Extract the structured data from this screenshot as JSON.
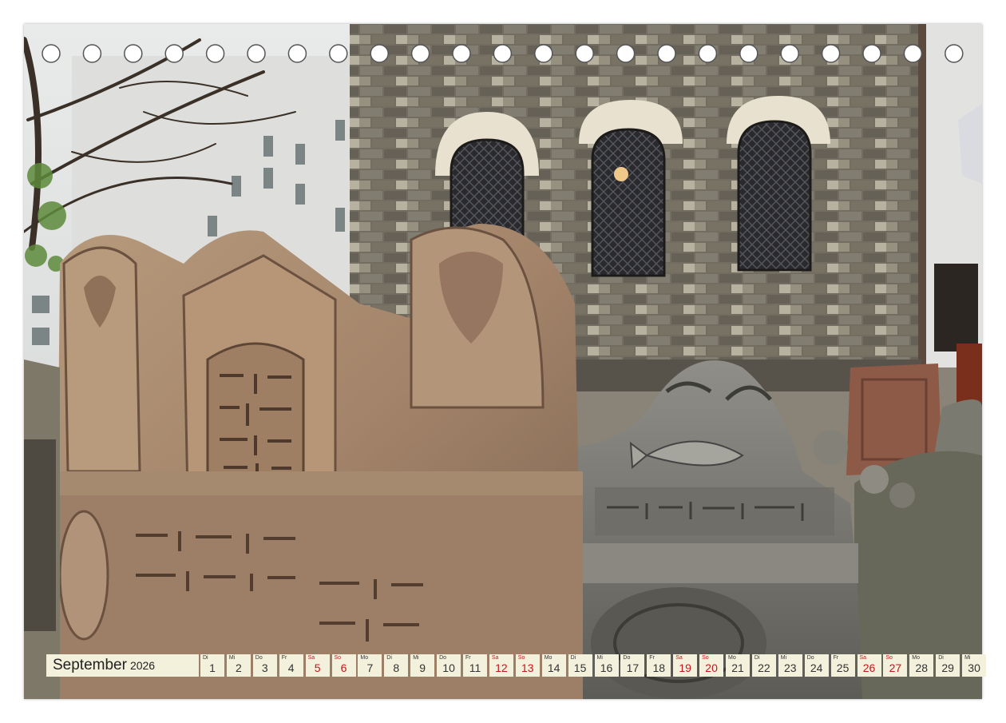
{
  "calendar": {
    "month": "September",
    "year": "2026",
    "days": [
      {
        "wd": "Di",
        "d": "1",
        "we": false
      },
      {
        "wd": "Mi",
        "d": "2",
        "we": false
      },
      {
        "wd": "Do",
        "d": "3",
        "we": false
      },
      {
        "wd": "Fr",
        "d": "4",
        "we": false
      },
      {
        "wd": "Sa",
        "d": "5",
        "we": true
      },
      {
        "wd": "So",
        "d": "6",
        "we": true
      },
      {
        "wd": "Mo",
        "d": "7",
        "we": false
      },
      {
        "wd": "Di",
        "d": "8",
        "we": false
      },
      {
        "wd": "Mi",
        "d": "9",
        "we": false
      },
      {
        "wd": "Do",
        "d": "10",
        "we": false
      },
      {
        "wd": "Fr",
        "d": "11",
        "we": false
      },
      {
        "wd": "Sa",
        "d": "12",
        "we": true
      },
      {
        "wd": "So",
        "d": "13",
        "we": true
      },
      {
        "wd": "Mo",
        "d": "14",
        "we": false
      },
      {
        "wd": "Di",
        "d": "15",
        "we": false
      },
      {
        "wd": "Mi",
        "d": "16",
        "we": false
      },
      {
        "wd": "Do",
        "d": "17",
        "we": false
      },
      {
        "wd": "Fr",
        "d": "18",
        "we": false
      },
      {
        "wd": "Sa",
        "d": "19",
        "we": true
      },
      {
        "wd": "So",
        "d": "20",
        "we": true
      },
      {
        "wd": "Mo",
        "d": "21",
        "we": false
      },
      {
        "wd": "Di",
        "d": "22",
        "we": false
      },
      {
        "wd": "Mi",
        "d": "23",
        "we": false
      },
      {
        "wd": "Do",
        "d": "24",
        "we": false
      },
      {
        "wd": "Fr",
        "d": "25",
        "we": false
      },
      {
        "wd": "Sa",
        "d": "26",
        "we": true
      },
      {
        "wd": "So",
        "d": "27",
        "we": true
      },
      {
        "wd": "Mo",
        "d": "28",
        "we": false
      },
      {
        "wd": "Di",
        "d": "29",
        "we": false
      },
      {
        "wd": "Mi",
        "d": "30",
        "we": false
      }
    ]
  },
  "binding_holes": 23,
  "colors": {
    "cell": "#f3f1dc",
    "weekend": "#c4151c",
    "text": "#333333"
  }
}
